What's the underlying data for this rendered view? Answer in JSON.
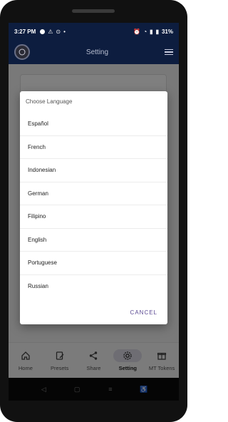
{
  "status_bar": {
    "time": "3:27",
    "period": "PM",
    "battery": "31%"
  },
  "app_bar": {
    "title": "Setting"
  },
  "dialog": {
    "title": "Choose Language",
    "options": [
      "Español",
      "French",
      "Indonesian",
      "German",
      "Filipino",
      "English",
      "Portuguese",
      "Russian"
    ],
    "cancel_label": "CANCEL"
  },
  "bottom_nav": {
    "items": [
      {
        "label": "Home",
        "icon": "home-icon"
      },
      {
        "label": "Presets",
        "icon": "preset-edit-icon"
      },
      {
        "label": "Share",
        "icon": "share-icon"
      },
      {
        "label": "Setting",
        "icon": "gear-icon"
      },
      {
        "label": "MT Tokens",
        "icon": "gift-icon"
      }
    ],
    "active": "Setting"
  },
  "colors": {
    "app_bar": "#0d1d3f",
    "accent": "#5b4a93",
    "scrim": "rgba(0,0,0,0.5)"
  }
}
